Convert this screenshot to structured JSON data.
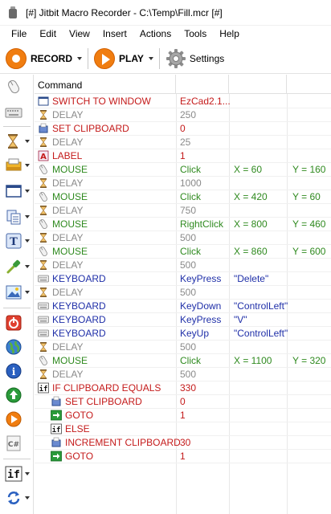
{
  "window": {
    "title": "[#] Jitbit Macro Recorder - C:\\Temp\\Fill.mcr [#]"
  },
  "menu": [
    "File",
    "Edit",
    "View",
    "Insert",
    "Actions",
    "Tools",
    "Help"
  ],
  "toolbar": {
    "record_label": "RECORD",
    "play_label": "PLAY",
    "settings_label": "Settings"
  },
  "grid": {
    "header": {
      "command": "Command"
    },
    "rows": [
      {
        "icon": "window-icon",
        "cmd": "SWITCH TO WINDOW",
        "p1": "EzCad2.1...",
        "p2": "",
        "p3": "",
        "color": "#c41a1a",
        "indent": 0
      },
      {
        "icon": "hourglass-icon",
        "cmd": "DELAY",
        "p1": "250",
        "p2": "",
        "p3": "",
        "color": "#8a8a8a",
        "indent": 0
      },
      {
        "icon": "clipboard-icon",
        "cmd": "SET CLIPBOARD",
        "p1": "0",
        "p2": "",
        "p3": "",
        "color": "#c41a1a",
        "indent": 0
      },
      {
        "icon": "hourglass-icon",
        "cmd": "DELAY",
        "p1": "25",
        "p2": "",
        "p3": "",
        "color": "#8a8a8a",
        "indent": 0
      },
      {
        "icon": "label-icon",
        "cmd": "LABEL",
        "p1": "1",
        "p2": "",
        "p3": "",
        "color": "#c41a1a",
        "indent": 0
      },
      {
        "icon": "mouse-icon",
        "cmd": "MOUSE",
        "p1": "Click",
        "p2": "X = 60",
        "p3": "Y = 160",
        "color": "#2f8a1f",
        "indent": 0
      },
      {
        "icon": "hourglass-icon",
        "cmd": "DELAY",
        "p1": "1000",
        "p2": "",
        "p3": "",
        "color": "#8a8a8a",
        "indent": 0
      },
      {
        "icon": "mouse-icon",
        "cmd": "MOUSE",
        "p1": "Click",
        "p2": "X = 420",
        "p3": "Y = 60",
        "color": "#2f8a1f",
        "indent": 0
      },
      {
        "icon": "hourglass-icon",
        "cmd": "DELAY",
        "p1": "750",
        "p2": "",
        "p3": "",
        "color": "#8a8a8a",
        "indent": 0
      },
      {
        "icon": "mouse-icon",
        "cmd": "MOUSE",
        "p1": "RightClick",
        "p2": "X = 800",
        "p3": "Y = 460",
        "color": "#2f8a1f",
        "indent": 0
      },
      {
        "icon": "hourglass-icon",
        "cmd": "DELAY",
        "p1": "500",
        "p2": "",
        "p3": "",
        "color": "#8a8a8a",
        "indent": 0
      },
      {
        "icon": "mouse-icon",
        "cmd": "MOUSE",
        "p1": "Click",
        "p2": "X = 860",
        "p3": "Y = 600",
        "color": "#2f8a1f",
        "indent": 0
      },
      {
        "icon": "hourglass-icon",
        "cmd": "DELAY",
        "p1": "500",
        "p2": "",
        "p3": "",
        "color": "#8a8a8a",
        "indent": 0
      },
      {
        "icon": "keyboard-icon",
        "cmd": "KEYBOARD",
        "p1": "KeyPress",
        "p2": "\"Delete\"",
        "p3": "",
        "color": "#1f2fa8",
        "indent": 0
      },
      {
        "icon": "hourglass-icon",
        "cmd": "DELAY",
        "p1": "500",
        "p2": "",
        "p3": "",
        "color": "#8a8a8a",
        "indent": 0
      },
      {
        "icon": "keyboard-icon",
        "cmd": "KEYBOARD",
        "p1": "KeyDown",
        "p2": "\"ControlLeft\"",
        "p3": "",
        "color": "#1f2fa8",
        "indent": 0
      },
      {
        "icon": "keyboard-icon",
        "cmd": "KEYBOARD",
        "p1": "KeyPress",
        "p2": "\"V\"",
        "p3": "",
        "color": "#1f2fa8",
        "indent": 0
      },
      {
        "icon": "keyboard-icon",
        "cmd": "KEYBOARD",
        "p1": "KeyUp",
        "p2": "\"ControlLeft\"",
        "p3": "",
        "color": "#1f2fa8",
        "indent": 0
      },
      {
        "icon": "hourglass-icon",
        "cmd": "DELAY",
        "p1": "500",
        "p2": "",
        "p3": "",
        "color": "#8a8a8a",
        "indent": 0
      },
      {
        "icon": "mouse-icon",
        "cmd": "MOUSE",
        "p1": "Click",
        "p2": "X = 1100",
        "p3": "Y = 320",
        "color": "#2f8a1f",
        "indent": 0
      },
      {
        "icon": "hourglass-icon",
        "cmd": "DELAY",
        "p1": "500",
        "p2": "",
        "p3": "",
        "color": "#8a8a8a",
        "indent": 0
      },
      {
        "icon": "if-icon",
        "cmd": "IF CLIPBOARD EQUALS",
        "p1": "330",
        "p2": "",
        "p3": "",
        "color": "#c41a1a",
        "indent": 0
      },
      {
        "icon": "clipboard-icon",
        "cmd": "SET CLIPBOARD",
        "p1": "0",
        "p2": "",
        "p3": "",
        "color": "#c41a1a",
        "indent": 1
      },
      {
        "icon": "goto-icon",
        "cmd": "GOTO",
        "p1": "1",
        "p2": "",
        "p3": "",
        "color": "#c41a1a",
        "indent": 1
      },
      {
        "icon": "if-icon",
        "cmd": "ELSE",
        "p1": "",
        "p2": "",
        "p3": "",
        "color": "#c41a1a",
        "indent": 1
      },
      {
        "icon": "clipboard-icon",
        "cmd": "INCREMENT CLIPBOARD",
        "p1": "30",
        "p2": "",
        "p3": "",
        "color": "#c41a1a",
        "indent": 1
      },
      {
        "icon": "goto-icon",
        "cmd": "GOTO",
        "p1": "1",
        "p2": "",
        "p3": "",
        "color": "#c41a1a",
        "indent": 1
      }
    ]
  },
  "leftbar": {
    "icons": [
      "mouse-icon",
      "keyboard-icon",
      "hourglass-icon",
      "clipboard-icon",
      "window-icon",
      "copy-icon",
      "text-icon",
      "eyedropper-icon",
      "image-icon",
      "stop-icon",
      "globe-icon",
      "info-icon",
      "upload-icon",
      "play-icon",
      "csharp-icon",
      "if-icon",
      "loop-icon"
    ]
  }
}
